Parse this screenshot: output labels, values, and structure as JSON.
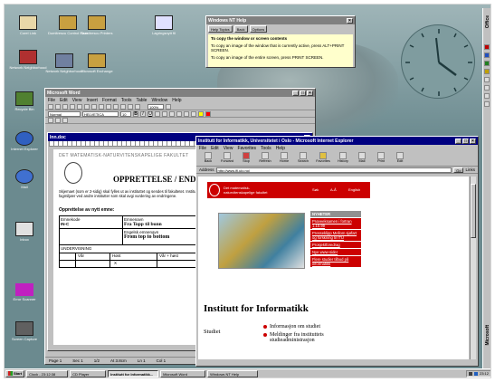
{
  "desktop": {
    "icons": [
      {
        "label": "Corel Link",
        "icon": "corel-icon"
      },
      {
        "label": "Dumitrescu Control Panel",
        "icon": "control-panel-icon"
      },
      {
        "label": "Dumitrescu Printers",
        "icon": "printers-icon"
      },
      {
        "label": "Lagringsnytt fil",
        "icon": "document-icon"
      },
      {
        "label": "Network Neighborhood",
        "icon": "network-icon"
      },
      {
        "label": "Network Neighborhood",
        "icon": "network-icon"
      },
      {
        "label": "Microsoft Exchange",
        "icon": "exchange-icon"
      },
      {
        "label": "Recycle Bin",
        "icon": "recycle-bin-icon"
      },
      {
        "label": "Internet Explorer",
        "icon": "ie-icon"
      },
      {
        "label": "Mail",
        "icon": "mail-icon"
      },
      {
        "label": "Inbox",
        "icon": "inbox-icon"
      },
      {
        "label": "Error Scanner",
        "icon": "error-scanner-icon"
      },
      {
        "label": "Screen Capture",
        "icon": "screen-capture-icon"
      }
    ]
  },
  "help_window": {
    "title": "Windows NT Help",
    "tabs": [
      "Help Topics",
      "Back",
      "Options"
    ],
    "heading": "To copy the window or screen contents",
    "step1": "To copy an image of the window that is currently active, press ALT+PRINT SCREEN.",
    "step2": "To copy an image of the entire screen, press PRINT SCREEN."
  },
  "word_window": {
    "title": "Microsoft Word",
    "doc_title": "Inn.doc",
    "menu": [
      "File",
      "Edit",
      "View",
      "Insert",
      "Format",
      "Tools",
      "Table",
      "Window",
      "Help"
    ],
    "style_value": "Normal",
    "font_value": "HELVETICA",
    "size_value": "10",
    "zoom_value": "100%",
    "faculty_header": "DET MATEMATISK-NATURVITENSKAPELIGE FAKULTET",
    "heading": "OPPRETTELSE / ENDRI",
    "body_text": "Skjemaet (som er 2-sidig) skal fylles ut av instituttet og sendes til fakultetet. Instituttet må selv ta stilling til om det skal sendes andre aktuelle fagmiljøer ved andre institutter som skal avgi vurdering av endringene.",
    "section_label": "Opprettelse av nytt emne:",
    "table_label_code": "Emnekode",
    "table_label_name": "Emnenavn",
    "code_value": "IN-C",
    "name_value": "Fra Topp til bunn",
    "english_label": "Engelsk emnenavn",
    "english_value": "From top to bottom",
    "teaching_label": "UNDERVISNING",
    "col_headers": [
      "Vår",
      "Høst",
      "Vår + høst",
      "Høst + vår"
    ],
    "col_mark": "X",
    "status_page": "Page 1",
    "status_sec": "Sec 1",
    "status_pos": "1/2",
    "status_at": "At 3.8cm",
    "status_ln": "Ln 1",
    "status_col": "Col 1"
  },
  "ie_window": {
    "title": "Institutt for Informatikk, Universitetet i Oslo - Microsoft Internet Explorer",
    "menu": [
      "File",
      "Edit",
      "View",
      "Favorites",
      "Tools",
      "Help"
    ],
    "toolbar_buttons": [
      "Back",
      "Forward",
      "Stop",
      "Refresh",
      "Home",
      "Search",
      "Favorites",
      "History",
      "Mail",
      "Print",
      "Edit"
    ],
    "address_label": "Address",
    "address_value": "http://www.ifi.uio.no/",
    "go_label": "Go",
    "links_label": "Links",
    "banner_text": "Det matematisk-naturvitenskapelige fakultet",
    "banner_links": [
      "Søk",
      "A-Å",
      "English"
    ],
    "nyheter_label": "NYHETER",
    "news_items": [
      "Prøveeksamen i fortran 1.10.99",
      "Presseklipp Mellom sjøfart og forskning til ITU",
      "Prosjektforedrag",
      "Nye www-sider",
      "Flere studier tilbud på informatikk"
    ],
    "page_title": "Institutt for Informatikk",
    "side_label": "Studiet",
    "bullets": [
      "Informasjon om studiet",
      "Meldinger fra instituttets studieadministrasjon"
    ]
  },
  "taskbar": {
    "start": "Start",
    "tasks": [
      "Clock - 23:12:38",
      "CD Player",
      "Institutt for Informatikk...",
      "Microsoft Word",
      "Windows NT Help"
    ],
    "clock": "23:12"
  },
  "office_bar": {
    "top": "Office",
    "bottom": "Microsoft"
  },
  "colors": {
    "desktop": "#6b8a8f",
    "title_active": "#000080",
    "title_inactive": "#808080",
    "ie_red": "#cc0000",
    "help_bg": "#ffffcc"
  }
}
